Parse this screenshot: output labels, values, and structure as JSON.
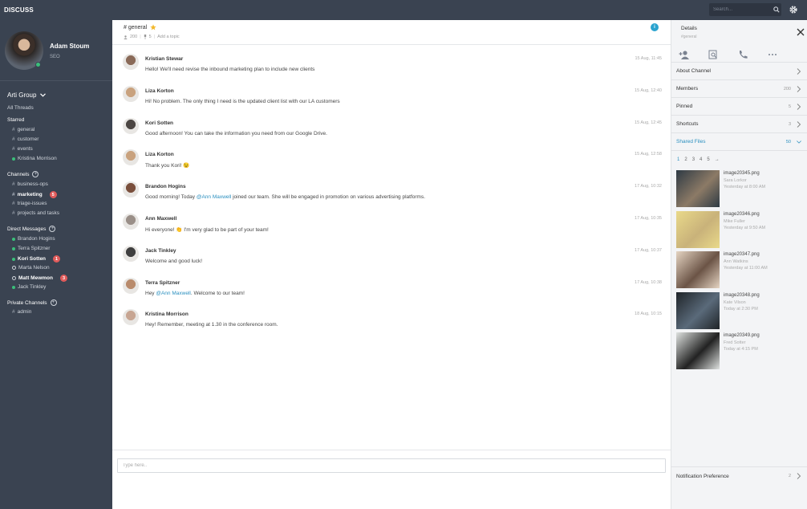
{
  "app": {
    "brand": "DISCUSS",
    "search_placeholder": "Search..."
  },
  "profile": {
    "name": "Adam Stoum",
    "role": "SEO"
  },
  "sidebar": {
    "group": "Arti Group",
    "all_threads": "All Threads",
    "starred_label": "Starred",
    "starred": [
      {
        "label": "general",
        "type": "channel"
      },
      {
        "label": "customer",
        "type": "channel"
      },
      {
        "label": "events",
        "type": "channel"
      },
      {
        "label": "Kristina Morrison",
        "type": "user-online"
      }
    ],
    "channels_label": "Channels",
    "channels": [
      {
        "label": "business-ops",
        "bold": false,
        "badge": ""
      },
      {
        "label": "marketing",
        "bold": true,
        "badge": "5"
      },
      {
        "label": "triage-issues",
        "bold": false,
        "badge": ""
      },
      {
        "label": "projects and tasks",
        "bold": false,
        "badge": ""
      }
    ],
    "dm_label": "Direct Messages",
    "dms": [
      {
        "label": "Brandon Hogins",
        "status": "online",
        "bold": false,
        "badge": ""
      },
      {
        "label": "Terra Spitzner",
        "status": "online",
        "bold": false,
        "badge": ""
      },
      {
        "label": "Kori Sotten",
        "status": "online",
        "bold": true,
        "badge": "1"
      },
      {
        "label": "Marta Nelson",
        "status": "offline",
        "bold": false,
        "badge": ""
      },
      {
        "label": "Matt Mewmon",
        "status": "offline",
        "bold": true,
        "badge": "3"
      },
      {
        "label": "Jack Tinkley",
        "status": "online",
        "bold": false,
        "badge": ""
      }
    ],
    "private_label": "Private Channels",
    "private": [
      {
        "label": "admin"
      }
    ]
  },
  "channel": {
    "title": "# general",
    "members": "200",
    "pins": "5",
    "topic_placeholder": "Add a topic",
    "info": "i"
  },
  "messages": [
    {
      "name": "Kristian Stewar",
      "time": "15 Aug, 11:45",
      "text": "Hello! We'll need revise the inbound marketing plan to include new clients",
      "color": "#8a6a58"
    },
    {
      "name": "Liza Korton",
      "time": "15 Aug, 12:40",
      "text": "Hi! No problem. The only thing I need is the updated client list with our LA customers",
      "color": "#c9a27e"
    },
    {
      "name": "Kori Sotten",
      "time": "15 Aug, 12:45",
      "text": "Good afternoon! You can take the information you need from our Google Drive.",
      "color": "#4c4643"
    },
    {
      "name": "Liza Korton",
      "time": "15 Aug, 12:58",
      "text": "Thank you Kori! 😉",
      "color": "#c9a27e"
    },
    {
      "name": "Brandon Hogins",
      "time": "17 Aug, 10:32",
      "text_pre": "Good morning! Today ",
      "mention": "@Ann Maxwell",
      "text_post": " joined our team. She will be engaged in promotion on various advertising platforms.",
      "color": "#7a4f3c"
    },
    {
      "name": "Ann Maxwell",
      "time": "17 Aug, 10:35",
      "text": "Hi everyone! 👏 I'm very glad to be part of your team!",
      "color": "#9a8f88"
    },
    {
      "name": "Jack Tinkley",
      "time": "17 Aug, 10:37",
      "text": "Welcome and good luck!",
      "color": "#3f3f3f"
    },
    {
      "name": "Terra Spitzner",
      "time": "17 Aug, 10:38",
      "text_pre": "Hey ",
      "mention": "@Ann Maxwell",
      "text_post": ". Welcome to our team!",
      "color": "#b98b6c"
    },
    {
      "name": "Kristina Morrison",
      "time": "18 Aug, 10:15",
      "text": "Hey! Remember, meeting at 1.30 in the conference room.",
      "color": "#c7a592"
    }
  ],
  "composer": {
    "placeholder": "Type here.."
  },
  "details": {
    "title": "Details",
    "subtitle": "#general",
    "rows": [
      {
        "label": "About Channel",
        "count": ""
      },
      {
        "label": "Members",
        "count": "200"
      },
      {
        "label": "Pinned",
        "count": "5"
      },
      {
        "label": "Shortcuts",
        "count": "3"
      },
      {
        "label": "Shared Files",
        "count": "50"
      }
    ],
    "pages": [
      "1",
      "2",
      "3",
      "4",
      "5",
      "→"
    ],
    "files": [
      {
        "name": "image20345.png",
        "by": "Sara Lorkor",
        "when": "Yesterday at 8:00 AM",
        "c1": "#2e3a44",
        "c2": "#8c7a66"
      },
      {
        "name": "image20346.png",
        "by": "Mike Fuller",
        "when": "Yesterday at 9:50 AM",
        "c1": "#e9d98a",
        "c2": "#c9b27a"
      },
      {
        "name": "image20347.png",
        "by": "Ann Watkins",
        "when": "Yesterday at 11:00 AM",
        "c1": "#e5d4c2",
        "c2": "#6b5446"
      },
      {
        "name": "image20348.png",
        "by": "Kate Vilson",
        "when": "Today at 2:30 PM",
        "c1": "#1f2428",
        "c2": "#5a6a7a"
      },
      {
        "name": "image20349.png",
        "by": "Fred Sotter",
        "when": "Today at 4:15 PM",
        "c1": "#dfe2e0",
        "c2": "#222"
      }
    ],
    "notif_label": "Notification Preference",
    "notif_count": "2"
  },
  "colors": {
    "sidebar": "#3a4351",
    "accent": "#2a8fbf",
    "online": "#3bbf7a",
    "badge": "#e05b5b"
  }
}
